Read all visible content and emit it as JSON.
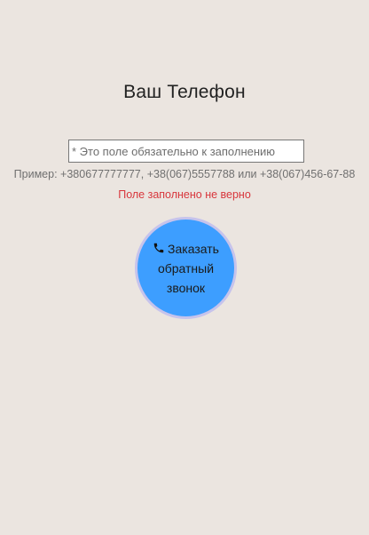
{
  "form": {
    "title": "Ваш Телефон",
    "phone_input": {
      "value": "",
      "placeholder": "* Это поле обязательно к заполнению"
    },
    "hint": "Пример: +380677777777, +38(067)5557788 или +38(067)456-67-88",
    "error": "Поле заполнено не верно"
  },
  "callback_button": {
    "icon": "phone-icon",
    "label": "Заказать обратный звонок"
  },
  "colors": {
    "background": "#ebe5e0",
    "button": "#3d9eff",
    "button_border": "#c6c3ec",
    "error": "#d8363c"
  }
}
